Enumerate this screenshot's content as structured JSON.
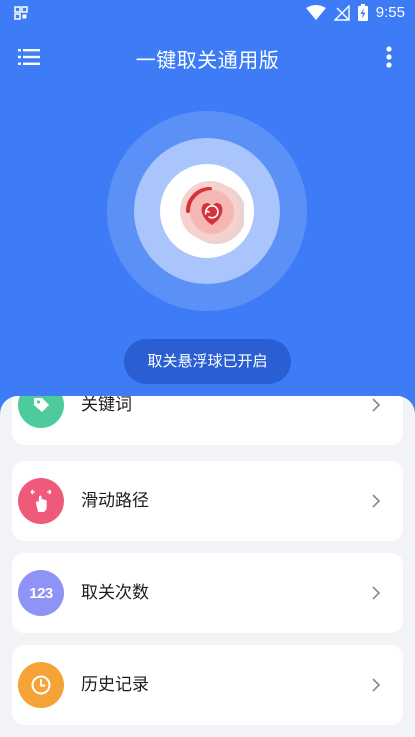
{
  "status_bar": {
    "time": "9:55"
  },
  "app_bar": {
    "title": "一键取关通用版"
  },
  "hero": {
    "status": "取关悬浮球已开启"
  },
  "menu": {
    "items": [
      {
        "label": "关键词",
        "icon": "tag-icon",
        "color": "#4ecb9c"
      },
      {
        "label": "滑动路径",
        "icon": "swipe-hand-icon",
        "color": "#ef5a7a"
      },
      {
        "label": "取关次数",
        "icon": "numbers-123-icon",
        "color": "#8f93f5",
        "icon_text": "123"
      },
      {
        "label": "历史记录",
        "icon": "clock-icon",
        "color": "#f5a236"
      }
    ]
  },
  "colors": {
    "primary": "#3d7cf6",
    "pill": "#2a5fd4",
    "background": "#f1f3f7"
  }
}
